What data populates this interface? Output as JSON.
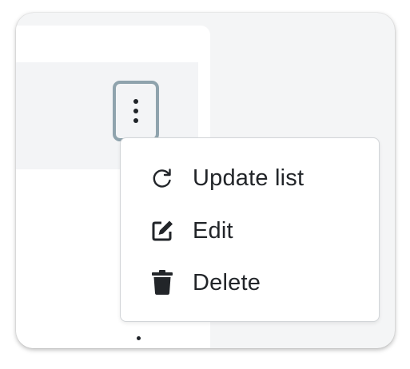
{
  "menu": {
    "trigger_icon": "kebab-vertical-icon",
    "items": [
      {
        "label": "Update list",
        "icon": "refresh-icon"
      },
      {
        "label": "Edit",
        "icon": "edit-icon"
      },
      {
        "label": "Delete",
        "icon": "trash-icon"
      }
    ]
  },
  "colors": {
    "focus_ring": "#8fa3ad",
    "text": "#222529",
    "menu_border": "#d2d5d8",
    "background": "#f4f5f6"
  }
}
